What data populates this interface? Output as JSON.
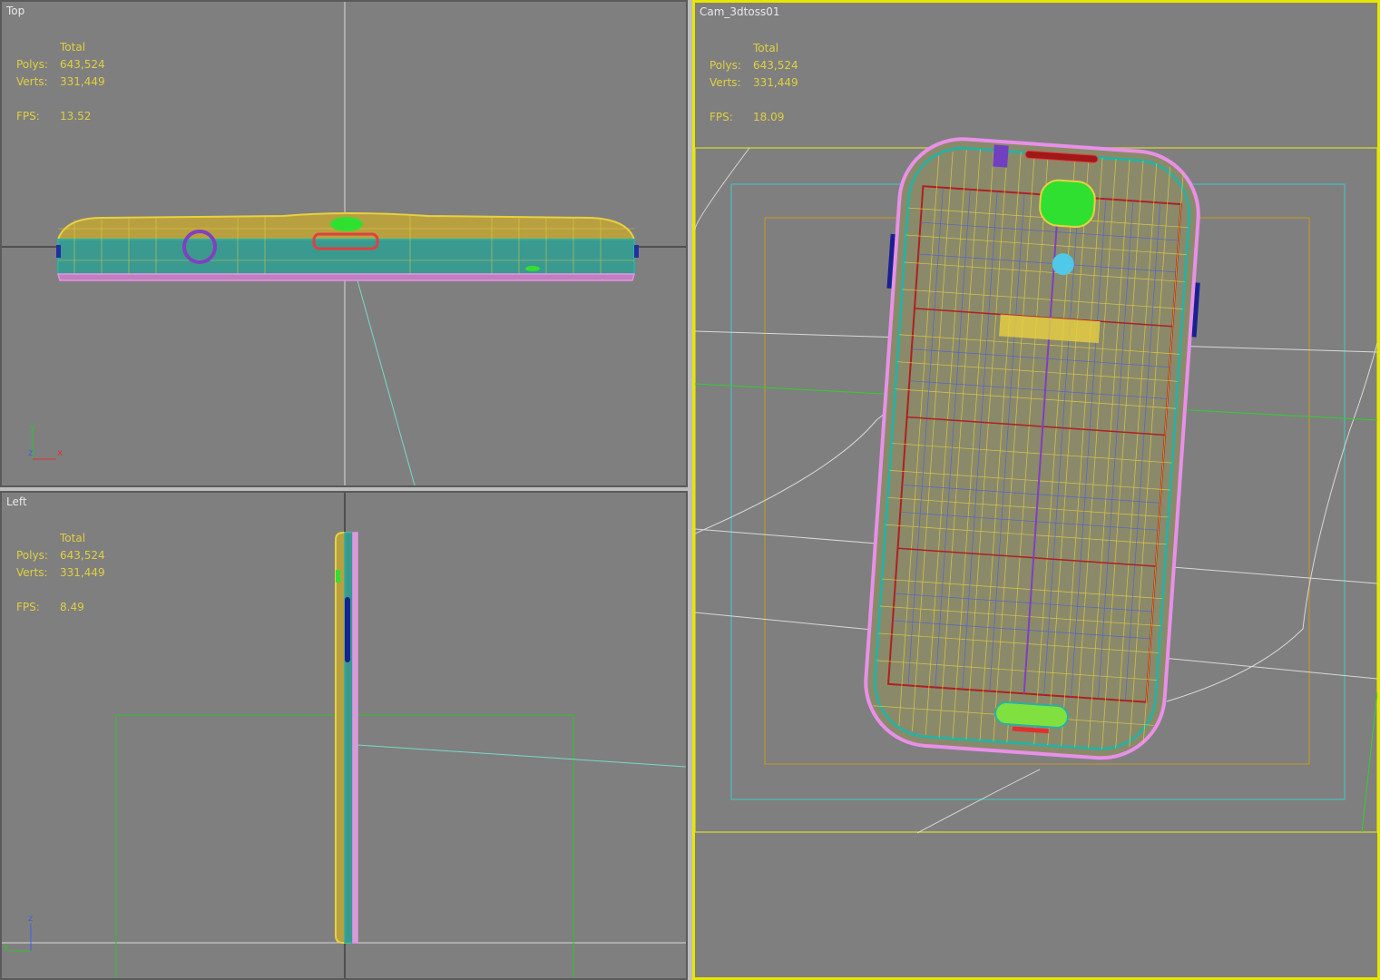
{
  "viewports": {
    "top": {
      "label": "Top",
      "stats": {
        "header": "Total",
        "polys_label": "Polys:",
        "polys": "643,524",
        "verts_label": "Verts:",
        "verts": "331,449",
        "fps_label": "FPS:",
        "fps": "13.52"
      },
      "axis": {
        "up": "y",
        "center": "z",
        "right": "x"
      }
    },
    "left": {
      "label": "Left",
      "stats": {
        "header": "Total",
        "polys_label": "Polys:",
        "polys": "643,524",
        "verts_label": "Verts:",
        "verts": "331,449",
        "fps_label": "FPS:",
        "fps": "8.49"
      },
      "axis": {
        "up": "z",
        "center": "y"
      }
    },
    "camera": {
      "label": "Cam_3dtoss01",
      "stats": {
        "header": "Total",
        "polys_label": "Polys:",
        "polys": "643,524",
        "verts_label": "Verts:",
        "verts": "331,449",
        "fps_label": "FPS:",
        "fps": "18.09"
      }
    }
  },
  "colors": {
    "viewport_bg": "#7f7f7f",
    "active_border": "#e6e600",
    "stats_text": "#e0d040",
    "wire_yellow": "#e8d040",
    "wire_teal": "#2ab0a0",
    "wire_pink": "#e890e8",
    "wire_blue": "#4a5ae0",
    "wire_red": "#b02020",
    "green": "#30e030"
  }
}
